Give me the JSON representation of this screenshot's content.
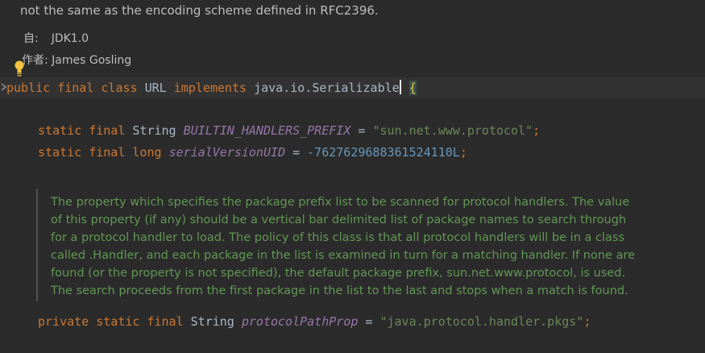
{
  "javadoc_top": {
    "line": "not the same as the encoding scheme defined in RFC2396.",
    "since_label": "自:",
    "since_value": "JDK1.0",
    "author_label": "作者:",
    "author_value": "James Gosling"
  },
  "code": {
    "class_decl": {
      "kw1": "public",
      "kw2": "final",
      "kw3": "class",
      "name": "URL",
      "kw4": "implements",
      "iface_pkg": "java.io.",
      "iface": "Serializable",
      "brace": "{"
    },
    "field1": {
      "kw1": "static",
      "kw2": "final",
      "type": "String",
      "name": "BUILTIN_HANDLERS_PREFIX",
      "op": "=",
      "value": "\"sun.net.www.protocol\"",
      "end": ";"
    },
    "field2": {
      "kw1": "static",
      "kw2": "final",
      "kw3": "long",
      "name": "serialVersionUID",
      "op": "=",
      "value": "-7627629688361524110L",
      "end": ";"
    },
    "field3": {
      "kw1": "private",
      "kw2": "static",
      "kw3": "final",
      "type": "String",
      "name": "protocolPathProp",
      "op": "=",
      "value": "\"java.protocol.handler.pkgs\"",
      "end": ";"
    }
  },
  "doc_comment": {
    "lines": [
      "The property which specifies the package prefix list to be scanned for protocol handlers. The value",
      "of this property (if any) should be a vertical bar delimited list of package names to search through",
      "for a protocol handler to load. The policy of this class is that all protocol handlers will be in a class",
      "called .Handler, and each package in the list is examined in turn for a matching handler. If none are",
      "found (or the property is not specified), the default package prefix, sun.net.www.protocol, is used.",
      "The search proceeds from the first package in the list to the last and stops when a match is found."
    ]
  },
  "icons": {
    "intention": "lightbulb-icon",
    "fold": "fold-arrow-icon"
  },
  "colors": {
    "background": "#2b2b2b",
    "keyword": "#cc7832",
    "string": "#6a8759",
    "number": "#6897bb",
    "static_field": "#9876aa",
    "doc_text": "#629755"
  }
}
